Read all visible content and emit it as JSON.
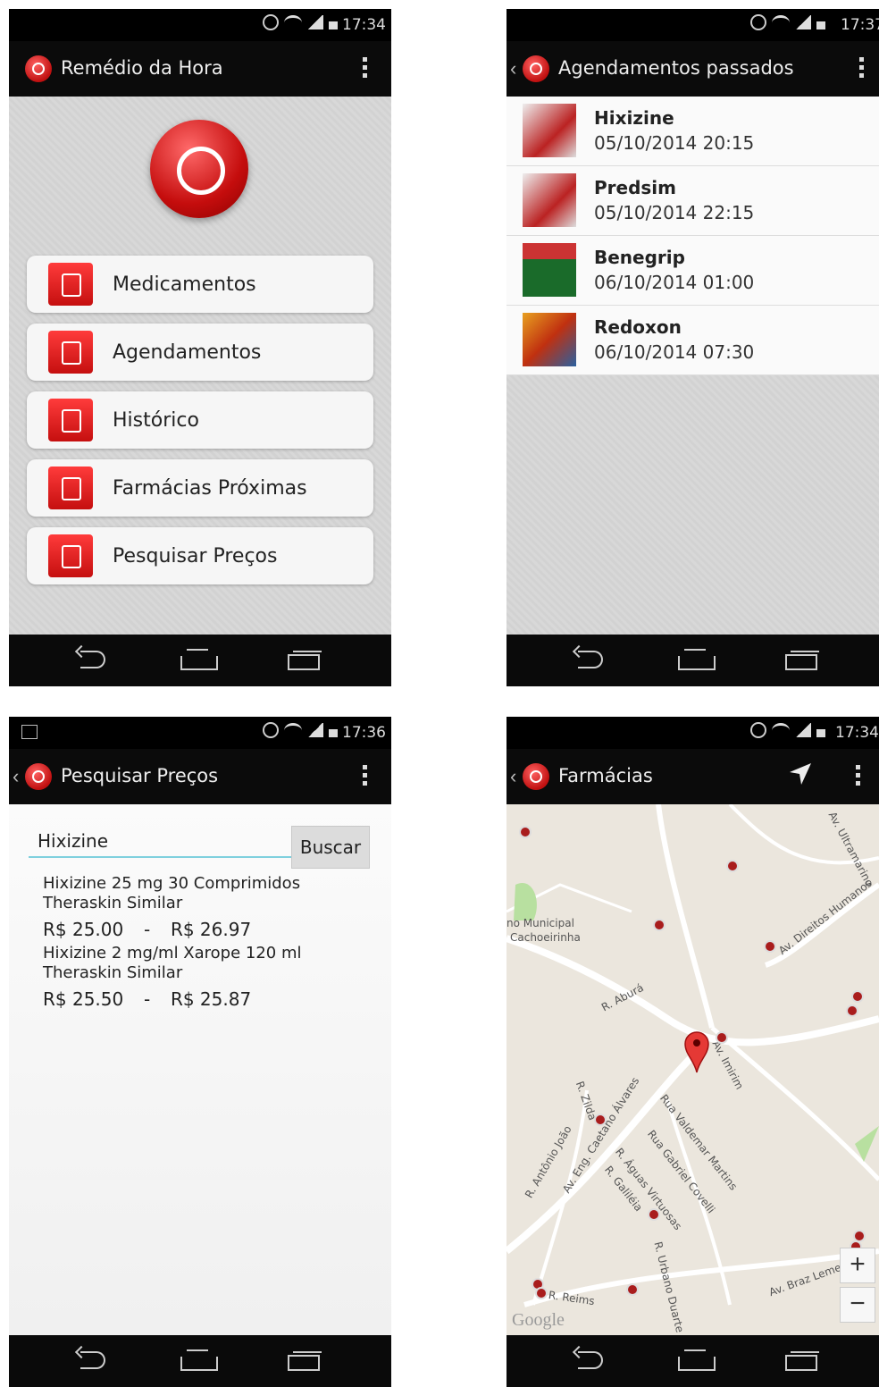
{
  "screen1": {
    "time": "17:34",
    "title": "Remédio da Hora",
    "menu": [
      {
        "label": "Medicamentos",
        "icon": "medicine-bottle-icon"
      },
      {
        "label": "Agendamentos",
        "icon": "calendar-clock-icon"
      },
      {
        "label": "Histórico",
        "icon": "clipboard-list-icon"
      },
      {
        "label": "Farmácias Próximas",
        "icon": "location-pin-icon"
      },
      {
        "label": "Pesquisar Preços",
        "icon": "price-search-icon"
      }
    ]
  },
  "screen2": {
    "time": "17:37",
    "title": "Agendamentos passados",
    "items": [
      {
        "name": "Hixizine",
        "date": "05/10/2014 20:15"
      },
      {
        "name": "Predsim",
        "date": "05/10/2014 22:15"
      },
      {
        "name": "Benegrip",
        "date": "06/10/2014 01:00"
      },
      {
        "name": "Redoxon",
        "date": "06/10/2014 07:30"
      }
    ]
  },
  "screen3": {
    "time": "17:36",
    "title": "Pesquisar Preços",
    "search_value": "Hixizine",
    "search_button": "Buscar",
    "results": [
      {
        "name": "Hixizine 25 mg 30 Comprimidos Theraskin Similar",
        "price_min": "R$ 25.00",
        "sep": "-",
        "price_max": "R$ 26.97"
      },
      {
        "name": "Hixizine 2 mg/ml Xarope 120 ml Theraskin Similar",
        "price_min": "R$ 25.50",
        "sep": "-",
        "price_max": "R$ 25.87"
      }
    ]
  },
  "screen4": {
    "time": "17:34",
    "title": "Farmácias",
    "streets": {
      "s1": "Av. Ultramarino",
      "s2": "Av. Direitos Humanos",
      "s3": "no Municipal",
      "s4": "Cachoeirinha",
      "s5": "R. Aburá",
      "s6": "Av. Imirim",
      "s7": "R. Zilda",
      "s8": "Av. Eng. Caetano Álvares",
      "s9": "Rua Valdemar Martins",
      "s10": "Rua Gabriel Covelli",
      "s11": "R. Antônio João",
      "s12": "R. Águas Virtuosas",
      "s13": "R. Galiléia",
      "s14": "R. Urbano Duarte",
      "s15": "Av. Braz Leme",
      "s16": "R. Reims"
    },
    "zoom_in": "+",
    "zoom_out": "−",
    "watermark": "Google"
  }
}
